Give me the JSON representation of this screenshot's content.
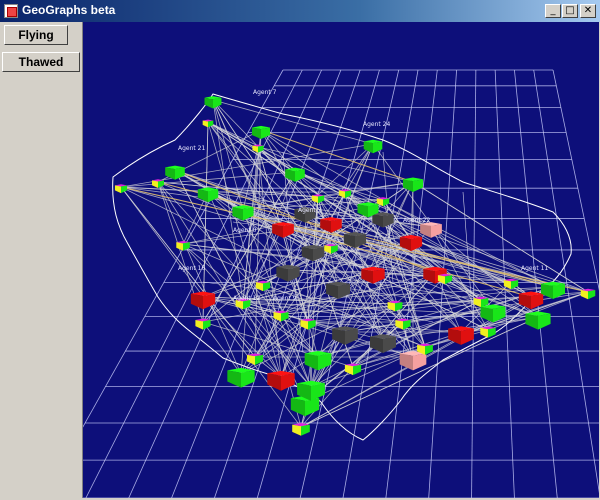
{
  "window": {
    "title": "GeoGraphs beta"
  },
  "controls": {
    "minimize": "_",
    "maximize": "□",
    "close": "✕"
  },
  "sidebar": {
    "buttons": [
      {
        "label": "Flying"
      },
      {
        "label": "Thawed"
      }
    ]
  },
  "scene": {
    "background": "#0d0f7a",
    "grid_color": "#cfd3ff",
    "edge_color": "#d8d8d8",
    "highlight_edge_color": "#e0c070",
    "node_colors": {
      "green": "#19e619",
      "red": "#e01010",
      "gray": "#4a4a4a",
      "pink": "#f5a0a0",
      "magenta": "#e020e0",
      "yellow": "#f0f020"
    },
    "agent_labels": [
      "Agent 7",
      "Agent 24",
      "Agent 21",
      "Agent 3",
      "Agent 22",
      "Agent 0",
      "Agent 16",
      "Agent 11",
      "Agent 12",
      "Agent 9"
    ]
  }
}
